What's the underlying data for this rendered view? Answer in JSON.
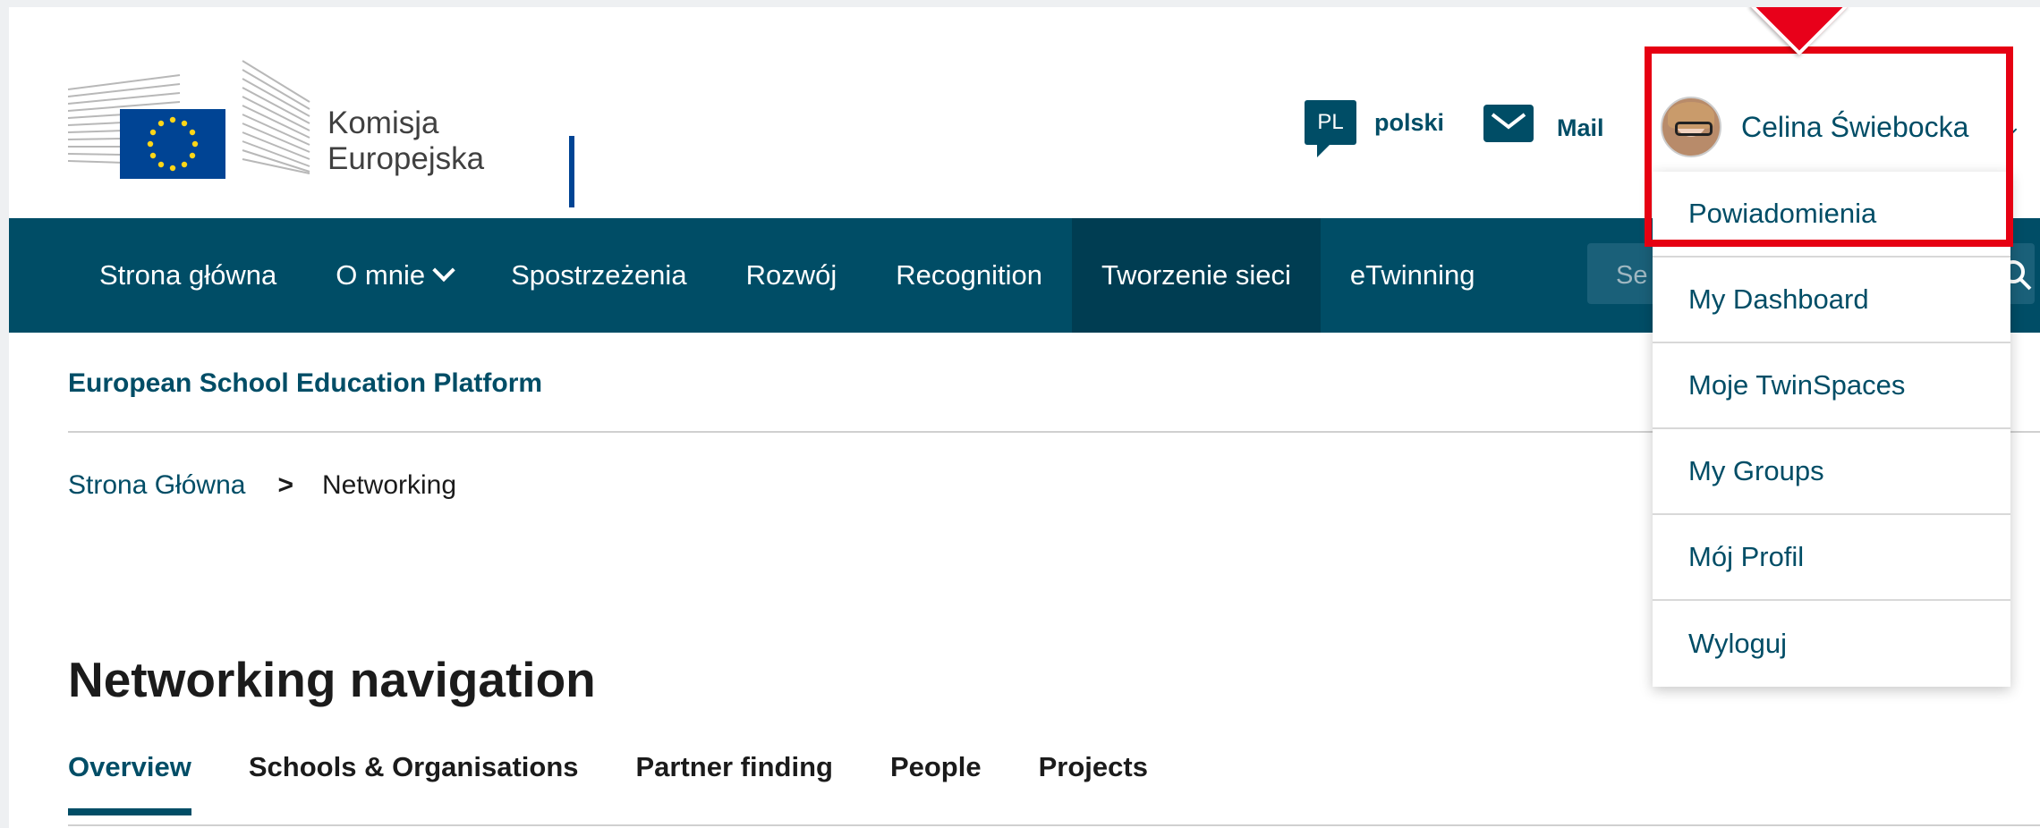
{
  "header": {
    "logo_lines": [
      "Komisja",
      "Europejska"
    ],
    "language": {
      "code": "PL",
      "label": "polski"
    },
    "mail_label": "Mail",
    "user": {
      "name": "Celina Świebocka"
    }
  },
  "nav": {
    "items": [
      {
        "label": "Strona główna"
      },
      {
        "label": "O mnie"
      },
      {
        "label": "Spostrzeżenia"
      },
      {
        "label": "Rozwój"
      },
      {
        "label": "Recognition"
      },
      {
        "label": "Tworzenie sieci"
      },
      {
        "label": "eTwinning"
      }
    ],
    "search_placeholder": "Se"
  },
  "site_name": "European School Education Platform",
  "breadcrumb": {
    "home": "Strona Główna",
    "separator": ">",
    "current": "Networking"
  },
  "page_title": "Networking navigation",
  "tabs": [
    {
      "label": "Overview"
    },
    {
      "label": "Schools & Organisations"
    },
    {
      "label": "Partner finding"
    },
    {
      "label": "People"
    },
    {
      "label": "Projects"
    }
  ],
  "user_menu": {
    "items": [
      {
        "label": "Powiadomienia"
      },
      {
        "label": "My Dashboard"
      },
      {
        "label": "Moje TwinSpaces"
      },
      {
        "label": "My Groups"
      },
      {
        "label": "Mój Profil"
      },
      {
        "label": "Wyloguj"
      }
    ]
  },
  "colors": {
    "brand": "#004d66",
    "nav_active": "#003d52",
    "highlight": "#e60012",
    "eu_blue": "#004494",
    "eu_gold": "#ffd617"
  }
}
